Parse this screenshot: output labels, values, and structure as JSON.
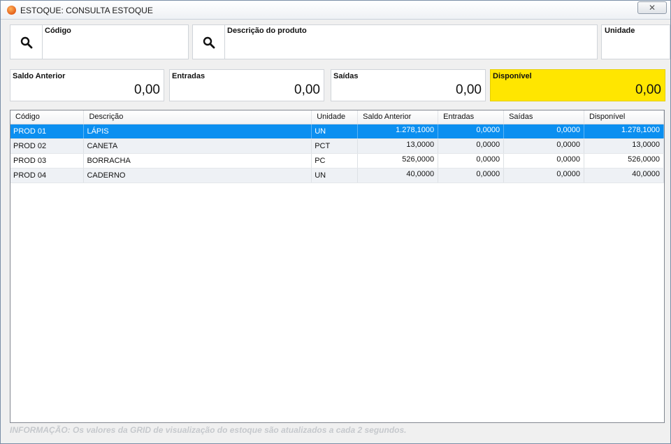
{
  "window": {
    "title": "ESTOQUE: CONSULTA ESTOQUE",
    "close_glyph": "✕"
  },
  "filters": {
    "codigo_label": "Código",
    "codigo_value": "",
    "descricao_label": "Descrição do produto",
    "descricao_value": "",
    "unidade_label": "Unidade",
    "unidade_value": ""
  },
  "summary": {
    "saldo_anterior": {
      "label": "Saldo Anterior",
      "value": "0,00"
    },
    "entradas": {
      "label": "Entradas",
      "value": "0,00"
    },
    "saidas": {
      "label": "Saídas",
      "value": "0,00"
    },
    "disponivel": {
      "label": "Disponível",
      "value": "0,00"
    }
  },
  "grid": {
    "columns": [
      "Código",
      "Descrição",
      "Unidade",
      "Saldo Anterior",
      "Entradas",
      "Saídas",
      "Disponível"
    ],
    "rows": [
      {
        "codigo": "PROD 01",
        "descricao": "LÁPIS",
        "unidade": "UN",
        "saldo_anterior": "1.278,1000",
        "entradas": "0,0000",
        "saidas": "0,0000",
        "disponivel": "1.278,1000"
      },
      {
        "codigo": "PROD 02",
        "descricao": "CANETA",
        "unidade": "PCT",
        "saldo_anterior": "13,0000",
        "entradas": "0,0000",
        "saidas": "0,0000",
        "disponivel": "13,0000"
      },
      {
        "codigo": "PROD 03",
        "descricao": "BORRACHA",
        "unidade": "PC",
        "saldo_anterior": "526,0000",
        "entradas": "0,0000",
        "saidas": "0,0000",
        "disponivel": "526,0000"
      },
      {
        "codigo": "PROD 04",
        "descricao": "CADERNO",
        "unidade": "UN",
        "saldo_anterior": "40,0000",
        "entradas": "0,0000",
        "saidas": "0,0000",
        "disponivel": "40,0000"
      }
    ],
    "selected_row": 0
  },
  "info_text": "INFORMAÇÃO: Os valores da GRID de visualização do estoque são atualizados a cada 2 segundos.",
  "colors": {
    "selection": "#0b8ff0",
    "highlight": "#ffe600"
  }
}
